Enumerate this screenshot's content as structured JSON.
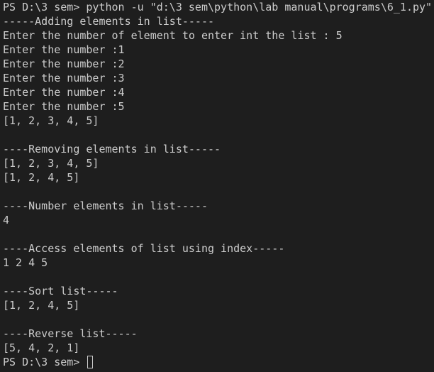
{
  "terminal": {
    "lines": [
      "PS D:\\3 sem> python -u \"d:\\3 sem\\python\\lab manual\\programs\\6_1.py\"",
      "-----Adding elements in list-----",
      "Enter the number of element to enter int the list : 5",
      "Enter the number :1",
      "Enter the number :2",
      "Enter the number :3",
      "Enter the number :4",
      "Enter the number :5",
      "[1, 2, 3, 4, 5]",
      "",
      "----Removing elements in list-----",
      "[1, 2, 3, 4, 5]",
      "[1, 2, 4, 5]",
      "",
      "----Number elements in list-----",
      "4",
      "",
      "----Access elements of list using index-----",
      "1 2 4 5",
      "",
      "----Sort list-----",
      "[1, 2, 4, 5]",
      "",
      "----Reverse list-----",
      "[5, 4, 2, 1]"
    ],
    "prompt": "PS D:\\3 sem> "
  },
  "colors": {
    "background": "#1e1e1e",
    "text": "#cccccc"
  }
}
